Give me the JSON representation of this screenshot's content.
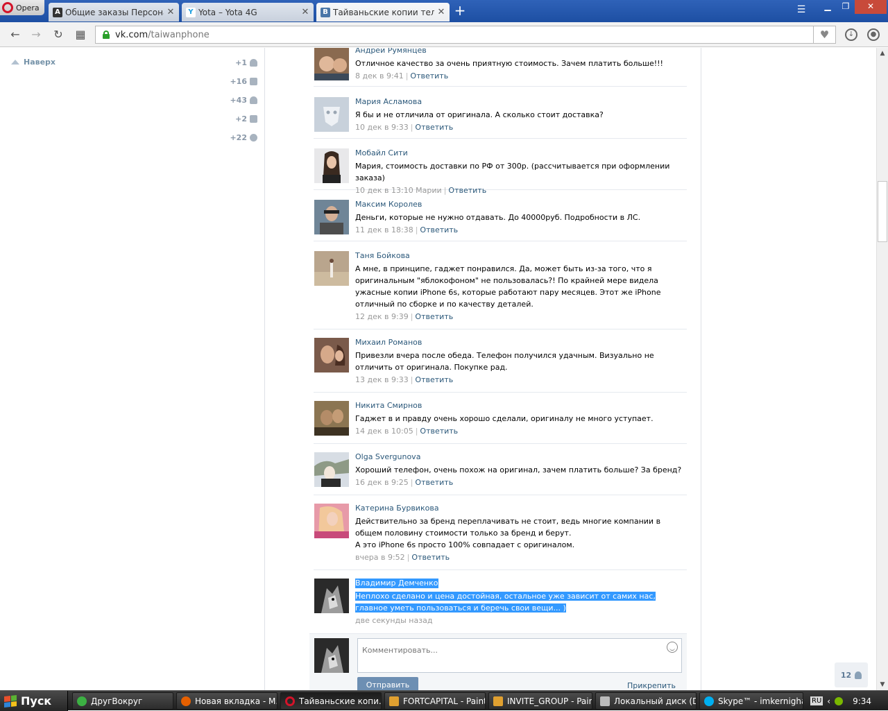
{
  "browser": {
    "menu_label": "Opera",
    "tabs": [
      {
        "favicon": "A",
        "title": "Общие заказы Персональные",
        "active": false
      },
      {
        "favicon": "Y",
        "title": "Yota – Yota 4G",
        "active": false
      },
      {
        "favicon": "B",
        "title": "Тайваньские копии телефонов",
        "active": true
      }
    ],
    "url_host": "vk.com",
    "url_path": "/taiwanphone"
  },
  "left_panel": {
    "to_top_label": "Наверх",
    "counters": [
      {
        "value": "+1",
        "icon": "person-icon"
      },
      {
        "value": "+16",
        "icon": "mail-icon"
      },
      {
        "value": "+43",
        "icon": "friends-icon"
      },
      {
        "value": "+2",
        "icon": "chat-icon"
      },
      {
        "value": "+22",
        "icon": "gear-icon"
      }
    ]
  },
  "comments": [
    {
      "author": "Андрей Румянцев",
      "lines": [
        "Отличное качество за очень приятную стоимость. Зачем платить больше!!!"
      ],
      "time": "8 дек в 9:41",
      "reply": "Ответить"
    },
    {
      "author": "Мария Асламова",
      "lines": [
        "Я бы и не отличила от оригинала. А сколько стоит доставка?"
      ],
      "time": "10 дек в 9:33",
      "reply": "Ответить"
    },
    {
      "author": "Мобайл Сити",
      "lines": [
        "Мария, стоимость доставки по РФ от 300р. (рассчитывается при оформлении заказа)"
      ],
      "time": "10 дек в 13:10 Марии",
      "reply": "Ответить"
    },
    {
      "author": "Максим Королев",
      "lines": [
        "Деньги, которые не нужно отдавать. До 40000руб. Подробности в ЛС."
      ],
      "time": "11 дек в 18:38",
      "reply": "Ответить"
    },
    {
      "author": "Таня Бойкова",
      "lines": [
        "А мне, в принципе, гаджет понравился. Да, может быть из-за того, что я оригинальным \"яблокофоном\" не пользовалась?! По крайней мере видела ужасные копии iPhone 6s, которые работают пару месяцев. Этот же iPhone отличный по сборке и по качеству деталей."
      ],
      "time": "12 дек в 9:39",
      "reply": "Ответить"
    },
    {
      "author": "Михаил Романов",
      "lines": [
        "Привезли вчера после обеда. Телефон получился удачным. Визуально не отличить от оригинала. Покупке рад."
      ],
      "time": "13 дек в 9:33",
      "reply": "Ответить"
    },
    {
      "author": "Никита Смирнов",
      "lines": [
        "Гаджет в и правду очень хорошо сделали, оригиналу не много уступает."
      ],
      "time": "14 дек в 10:05",
      "reply": "Ответить"
    },
    {
      "author": "Olga Svergunova",
      "lines": [
        "Хороший телефон, очень похож на оригинал, зачем платить больше? За бренд?"
      ],
      "time": "16 дек в 9:25",
      "reply": "Ответить"
    },
    {
      "author": "Катерина Бурвикова",
      "lines": [
        "Действительно за бренд переплачивать не стоит, ведь многие компании в общем половину стоимости только за бренд и берут.",
        "А это iPhone 6s просто 100% совпадает с оригиналом."
      ],
      "time": "вчера в 9:52",
      "reply": "Ответить"
    },
    {
      "author": "Владимир Демченко",
      "lines": [
        "Неплохо сделано и цена достойная, остальное уже зависит от самих нас, главное уметь пользоваться и беречь свои вещи... )"
      ],
      "time": "две секунды назад",
      "reply": ""
    }
  ],
  "composer": {
    "placeholder": "Комментировать...",
    "send_label": "Отправить",
    "attach_label": "Прикрепить"
  },
  "online_count": "12",
  "taskbar": {
    "start_label": "Пуск",
    "tasks": [
      {
        "label": "ДругВокруг",
        "color": "#3cb043",
        "active": false
      },
      {
        "label": "Новая вкладка - M...",
        "color": "#e66000",
        "active": false
      },
      {
        "label": "Тайваньские копи...",
        "color": "#d3142a",
        "active": true
      },
      {
        "label": "FORTCAPITAL - Paint",
        "color": "#e0a030",
        "active": false
      },
      {
        "label": "INVITE_GROUP - Paint",
        "color": "#e0a030",
        "active": false
      },
      {
        "label": "Локальный диск (D:)",
        "color": "#bbbbbb",
        "active": false
      },
      {
        "label": "Skype™ - imkernighan",
        "color": "#00aff0",
        "active": false
      }
    ],
    "lang": "RU",
    "time": "9:34"
  }
}
